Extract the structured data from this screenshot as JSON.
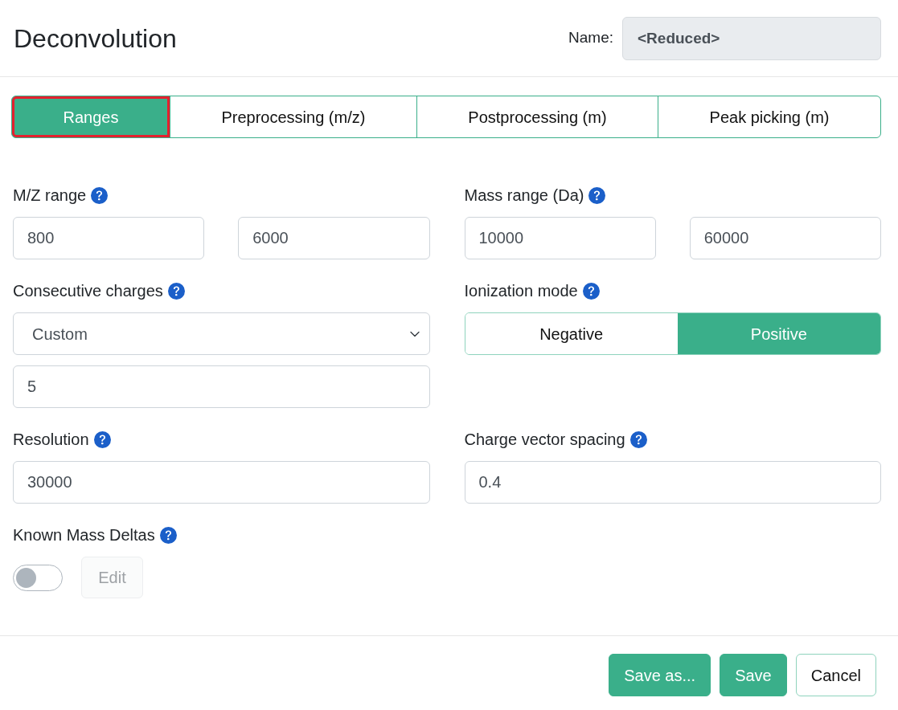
{
  "header": {
    "title": "Deconvolution",
    "name_label": "Name:",
    "name_value": "<Reduced>"
  },
  "tabs": [
    {
      "label": "Ranges",
      "selected": true
    },
    {
      "label": "Preprocessing (m/z)",
      "selected": false
    },
    {
      "label": "Postprocessing (m)",
      "selected": false
    },
    {
      "label": "Peak picking (m)",
      "selected": false
    }
  ],
  "form_rows": [
    [
      {
        "kind": "range",
        "label": "M/Z range",
        "values": [
          "800",
          "6000"
        ]
      },
      {
        "kind": "range",
        "label": "Mass range (Da)",
        "values": [
          "10000",
          "60000"
        ]
      }
    ],
    [
      {
        "kind": "select",
        "label": "Consecutive charges",
        "selected_option": "Custom",
        "value": "5"
      },
      {
        "kind": "segmented",
        "label": "Ionization mode",
        "options": [
          {
            "label": "Negative",
            "selected": false
          },
          {
            "label": "Positive",
            "selected": true
          }
        ]
      }
    ],
    [
      {
        "kind": "input",
        "label": "Resolution",
        "value": "30000"
      },
      {
        "kind": "input",
        "label": "Charge vector spacing",
        "value": "0.4"
      }
    ],
    [
      {
        "kind": "toggle",
        "label": "Known Mass Deltas",
        "on": false,
        "button": {
          "label": "Edit",
          "disabled": true
        }
      }
    ]
  ],
  "footer_buttons": [
    {
      "label": "Save as...",
      "kind": "primary"
    },
    {
      "label": "Save",
      "kind": "primary"
    },
    {
      "label": "Cancel",
      "kind": "secondary"
    }
  ]
}
